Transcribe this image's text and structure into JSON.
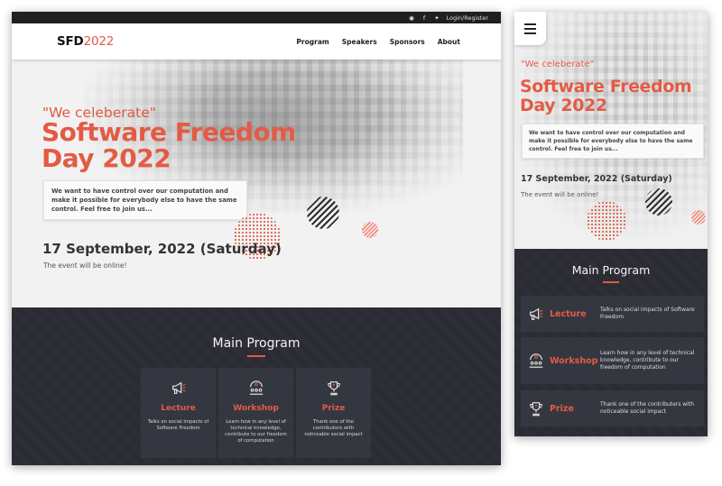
{
  "desktop": {
    "topbar": {
      "icons": [
        "mastodon-icon",
        "facebook-icon",
        "twitter-icon"
      ],
      "login_label": "Login/Register"
    },
    "brand": {
      "name": "SFD",
      "year": "2022"
    },
    "nav": [
      "Program",
      "Speakers",
      "Sponsors",
      "About"
    ],
    "hero": {
      "quote": "\"We celeberate\"",
      "title_line1": "Software Freedom",
      "title_line2": "Day 2022",
      "intro": "We want to have control over our computation and make it possible for everybody else to have the same control. Feel free to join us...",
      "date": "17 September, 2022 (Saturday)",
      "online": "The event will be online!"
    },
    "program": {
      "title": "Main Program",
      "items": [
        {
          "name": "Lecture",
          "icon": "megaphone-icon",
          "desc": "Talks on social impacts of Software Freedom"
        },
        {
          "name": "Workshop",
          "icon": "workshop-icon",
          "desc": "Learn how in any level of technical knowledge, contribute to our freedom of computation"
        },
        {
          "name": "Prize",
          "icon": "trophy-icon",
          "desc": "Thank one of the contributers with noticeable social impact"
        }
      ]
    }
  },
  "mobile": {
    "hero": {
      "quote": "\"We celeberate\"",
      "title_line1": "Software Freedom",
      "title_line2": "Day 2022",
      "intro": "We want to have control over our computation and make it possible for everybody else to have the same control. Feel free to join us...",
      "date": "17 September, 2022 (Saturday)",
      "online": "The event will be online!"
    },
    "program": {
      "title": "Main Program",
      "items": [
        {
          "name": "Lecture",
          "icon": "megaphone-icon",
          "desc": "Talks on social impacts of Software Freedom"
        },
        {
          "name": "Workshop",
          "icon": "workshop-icon",
          "desc": "Learn how in any level of technical knowledge, contribute to our freedom of computation"
        },
        {
          "name": "Prize",
          "icon": "trophy-icon",
          "desc": "Thank one of the contributers with noticeable social impact"
        }
      ]
    }
  },
  "colors": {
    "accent": "#e35b45",
    "dark_bg": "#2b2c33",
    "card_bg": "#353740",
    "hero_bg": "#f2f2f2"
  }
}
